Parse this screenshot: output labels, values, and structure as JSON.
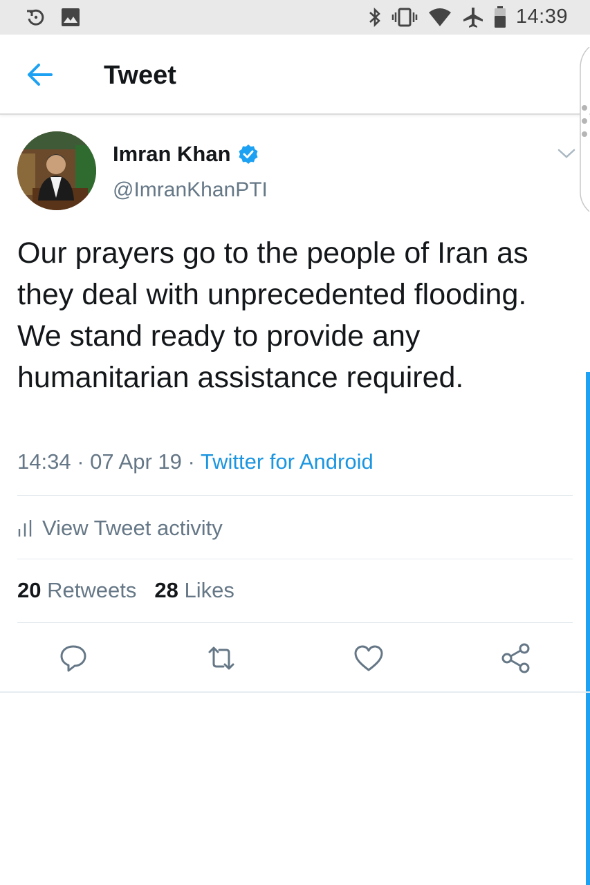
{
  "status_bar": {
    "time": "14:39",
    "icons": [
      "rotate-icon",
      "image-icon",
      "bluetooth-icon",
      "vibrate-icon",
      "wifi-icon",
      "airplane-icon",
      "battery-icon"
    ]
  },
  "app_bar": {
    "title": "Tweet",
    "back_icon": "back-arrow-icon"
  },
  "tweet": {
    "author": {
      "name": "Imran Khan",
      "handle": "@ImranKhanPTI",
      "verified": true
    },
    "text": "Our prayers go to the people of Iran as they deal with unprecedented flooding. We stand ready to provide any humanitarian assistance required.",
    "time": "14:34",
    "separator": " · ",
    "date": "07 Apr 19",
    "source": "Twitter for Android",
    "activity_label": "View Tweet activity",
    "retweets_count": "20",
    "retweets_label": "Retweets",
    "likes_count": "28",
    "likes_label": "Likes"
  },
  "actions": [
    "reply-icon",
    "retweet-icon",
    "like-icon",
    "share-icon"
  ],
  "colors": {
    "accent": "#1da1f2",
    "link": "#1b95e0",
    "secondary_text": "#657786",
    "primary_text": "#14171a",
    "status_bar_bg": "#e9e9e9"
  }
}
